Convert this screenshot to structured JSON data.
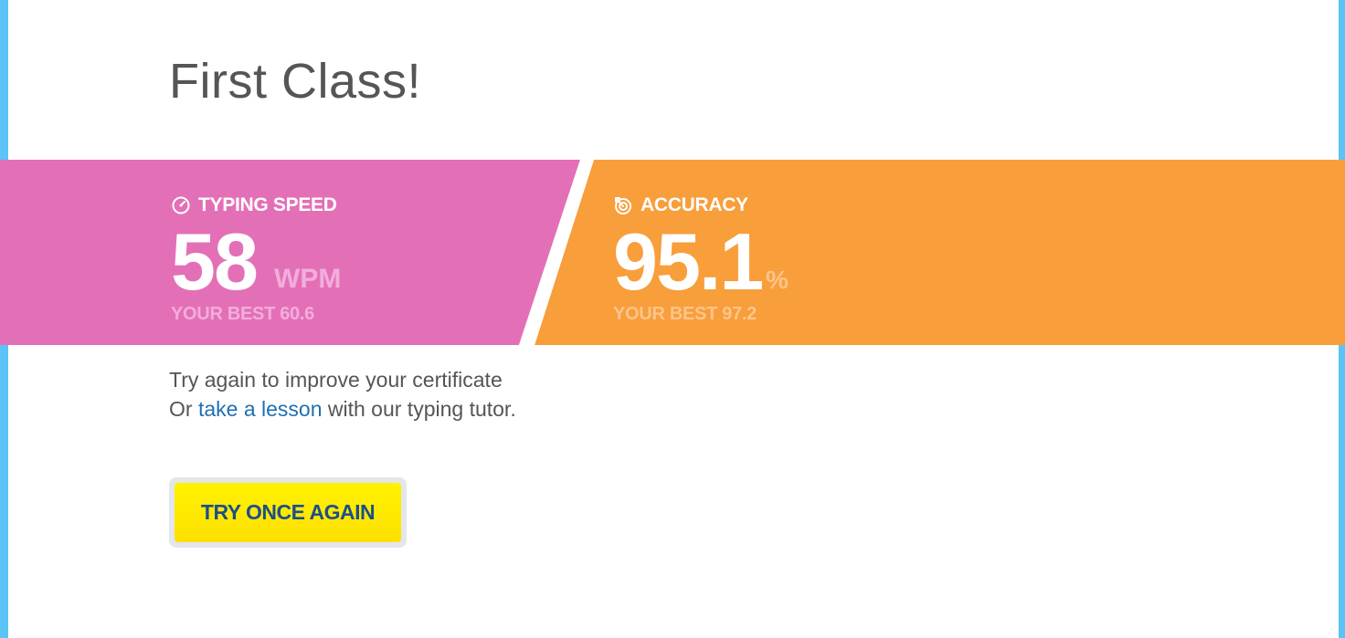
{
  "result": {
    "title": "First Class!"
  },
  "speed": {
    "label": "TYPING SPEED",
    "icon": "speedometer-icon",
    "value": "58",
    "unit": "WPM",
    "best": "YOUR BEST 60.6",
    "color": "#e370b7"
  },
  "accuracy": {
    "label": "ACCURACY",
    "icon": "target-icon",
    "value": "95.1",
    "unit": "%",
    "best": "YOUR BEST 97.2",
    "color": "#f89e3b"
  },
  "message": {
    "line1": "Try again to improve your certificate",
    "line2_prefix": "Or",
    "link": "take a lesson",
    "line2_suffix": "with our typing tutor."
  },
  "action": {
    "button_label": "TRY ONCE AGAIN",
    "button_color": "#ffea00"
  },
  "colors": {
    "page_background": "#5bc3f5",
    "link": "#1f6fb2"
  }
}
